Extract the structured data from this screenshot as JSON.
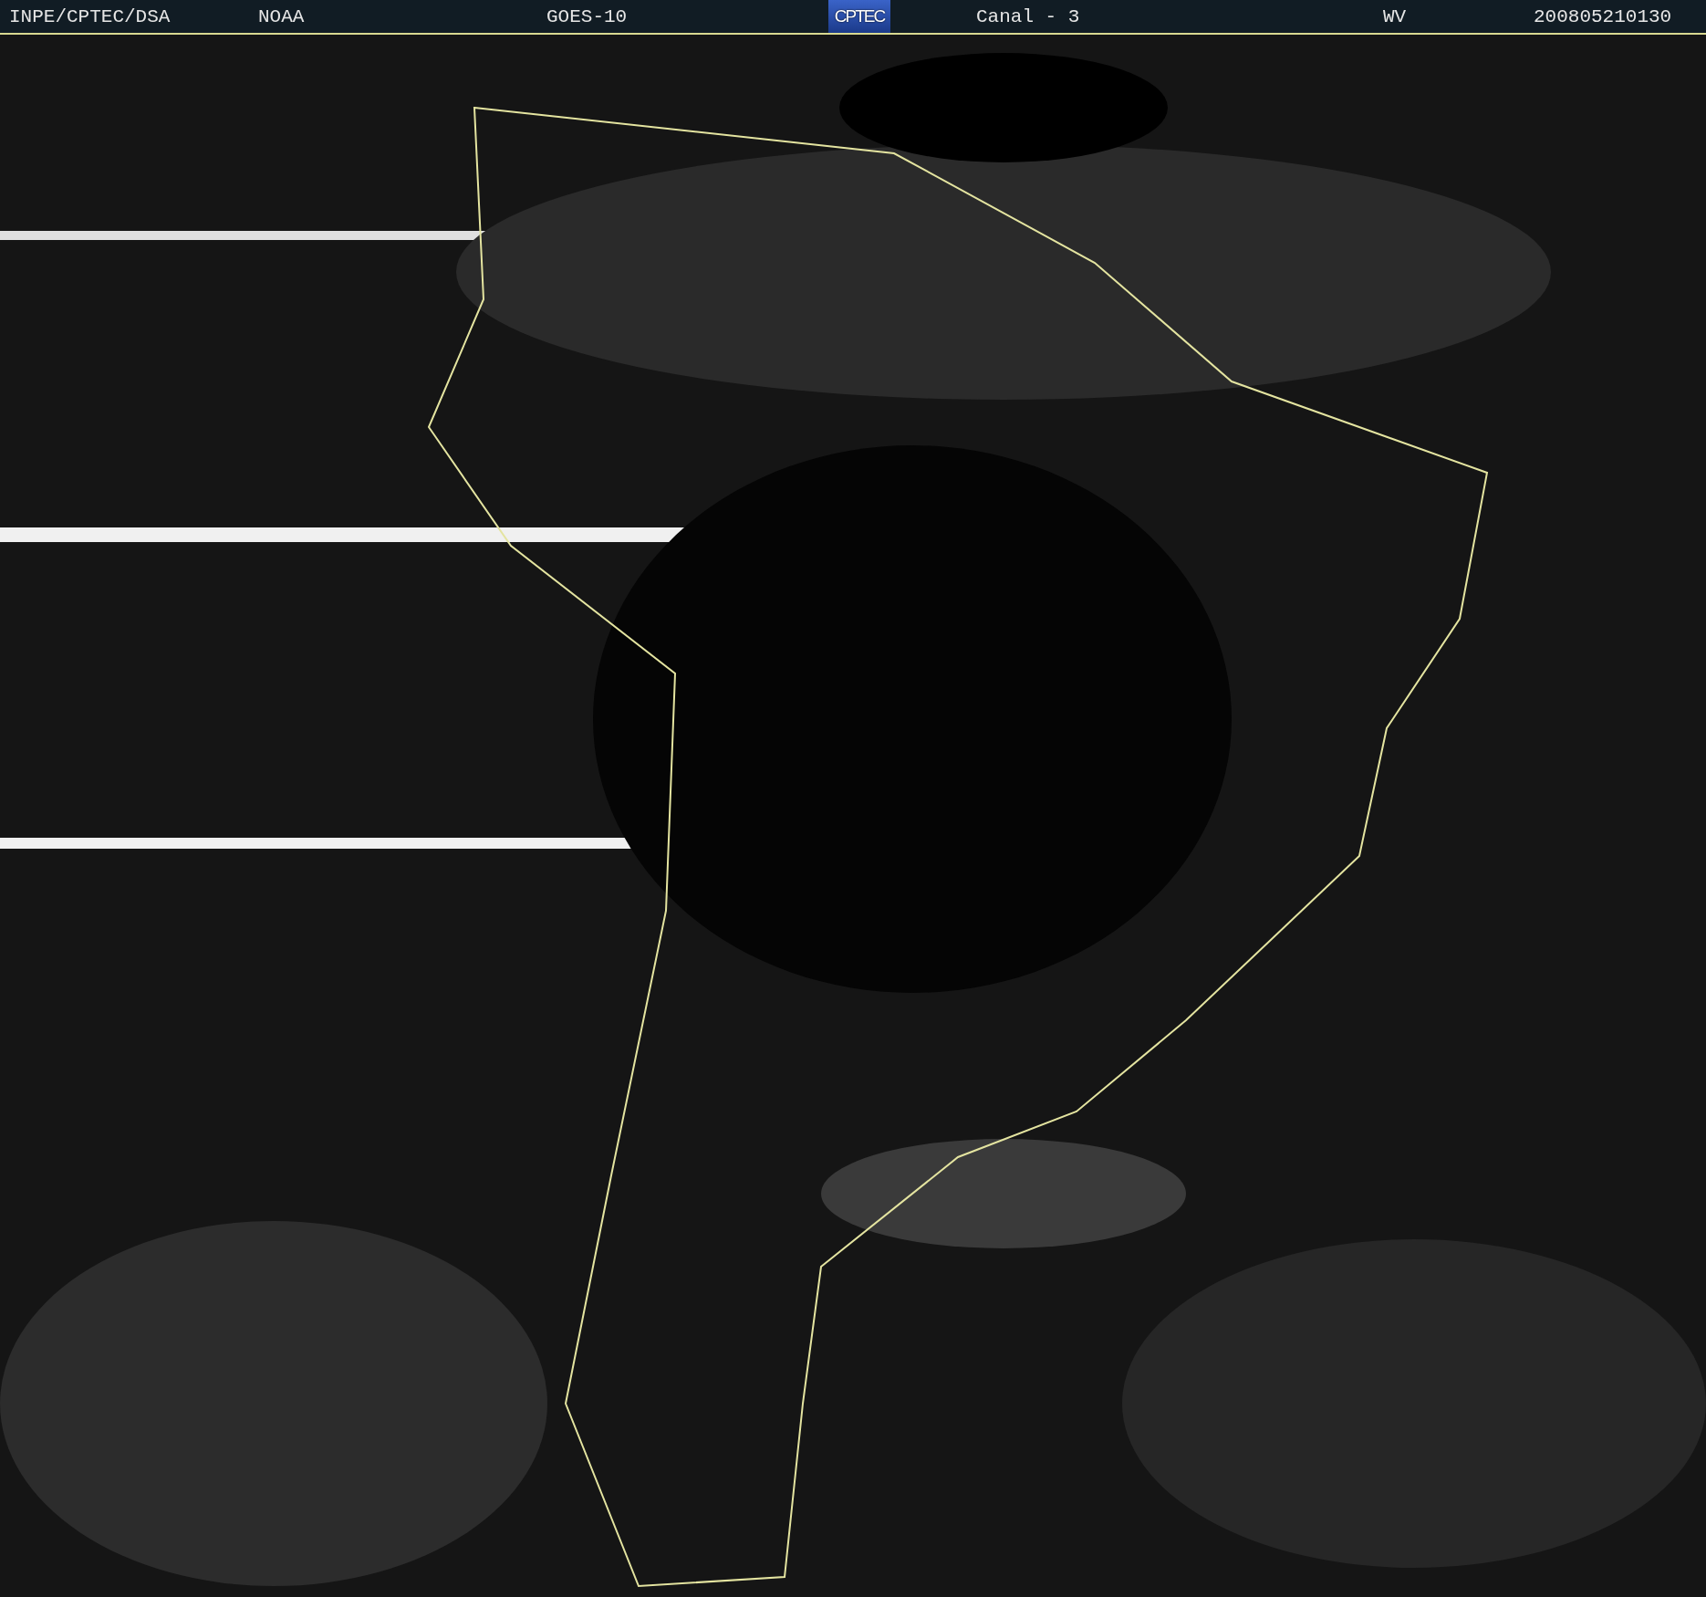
{
  "header": {
    "items": [
      {
        "kind": "text",
        "text": "INPE/CPTEC/DSA"
      },
      {
        "kind": "text",
        "text": "NOAA"
      },
      {
        "kind": "text",
        "text": "GOES-10"
      },
      {
        "kind": "logo",
        "text": "CPTEC"
      },
      {
        "kind": "text",
        "text": "Canal - 3"
      },
      {
        "kind": "text",
        "text": "WV"
      },
      {
        "kind": "text",
        "text": "200805210130"
      }
    ]
  }
}
